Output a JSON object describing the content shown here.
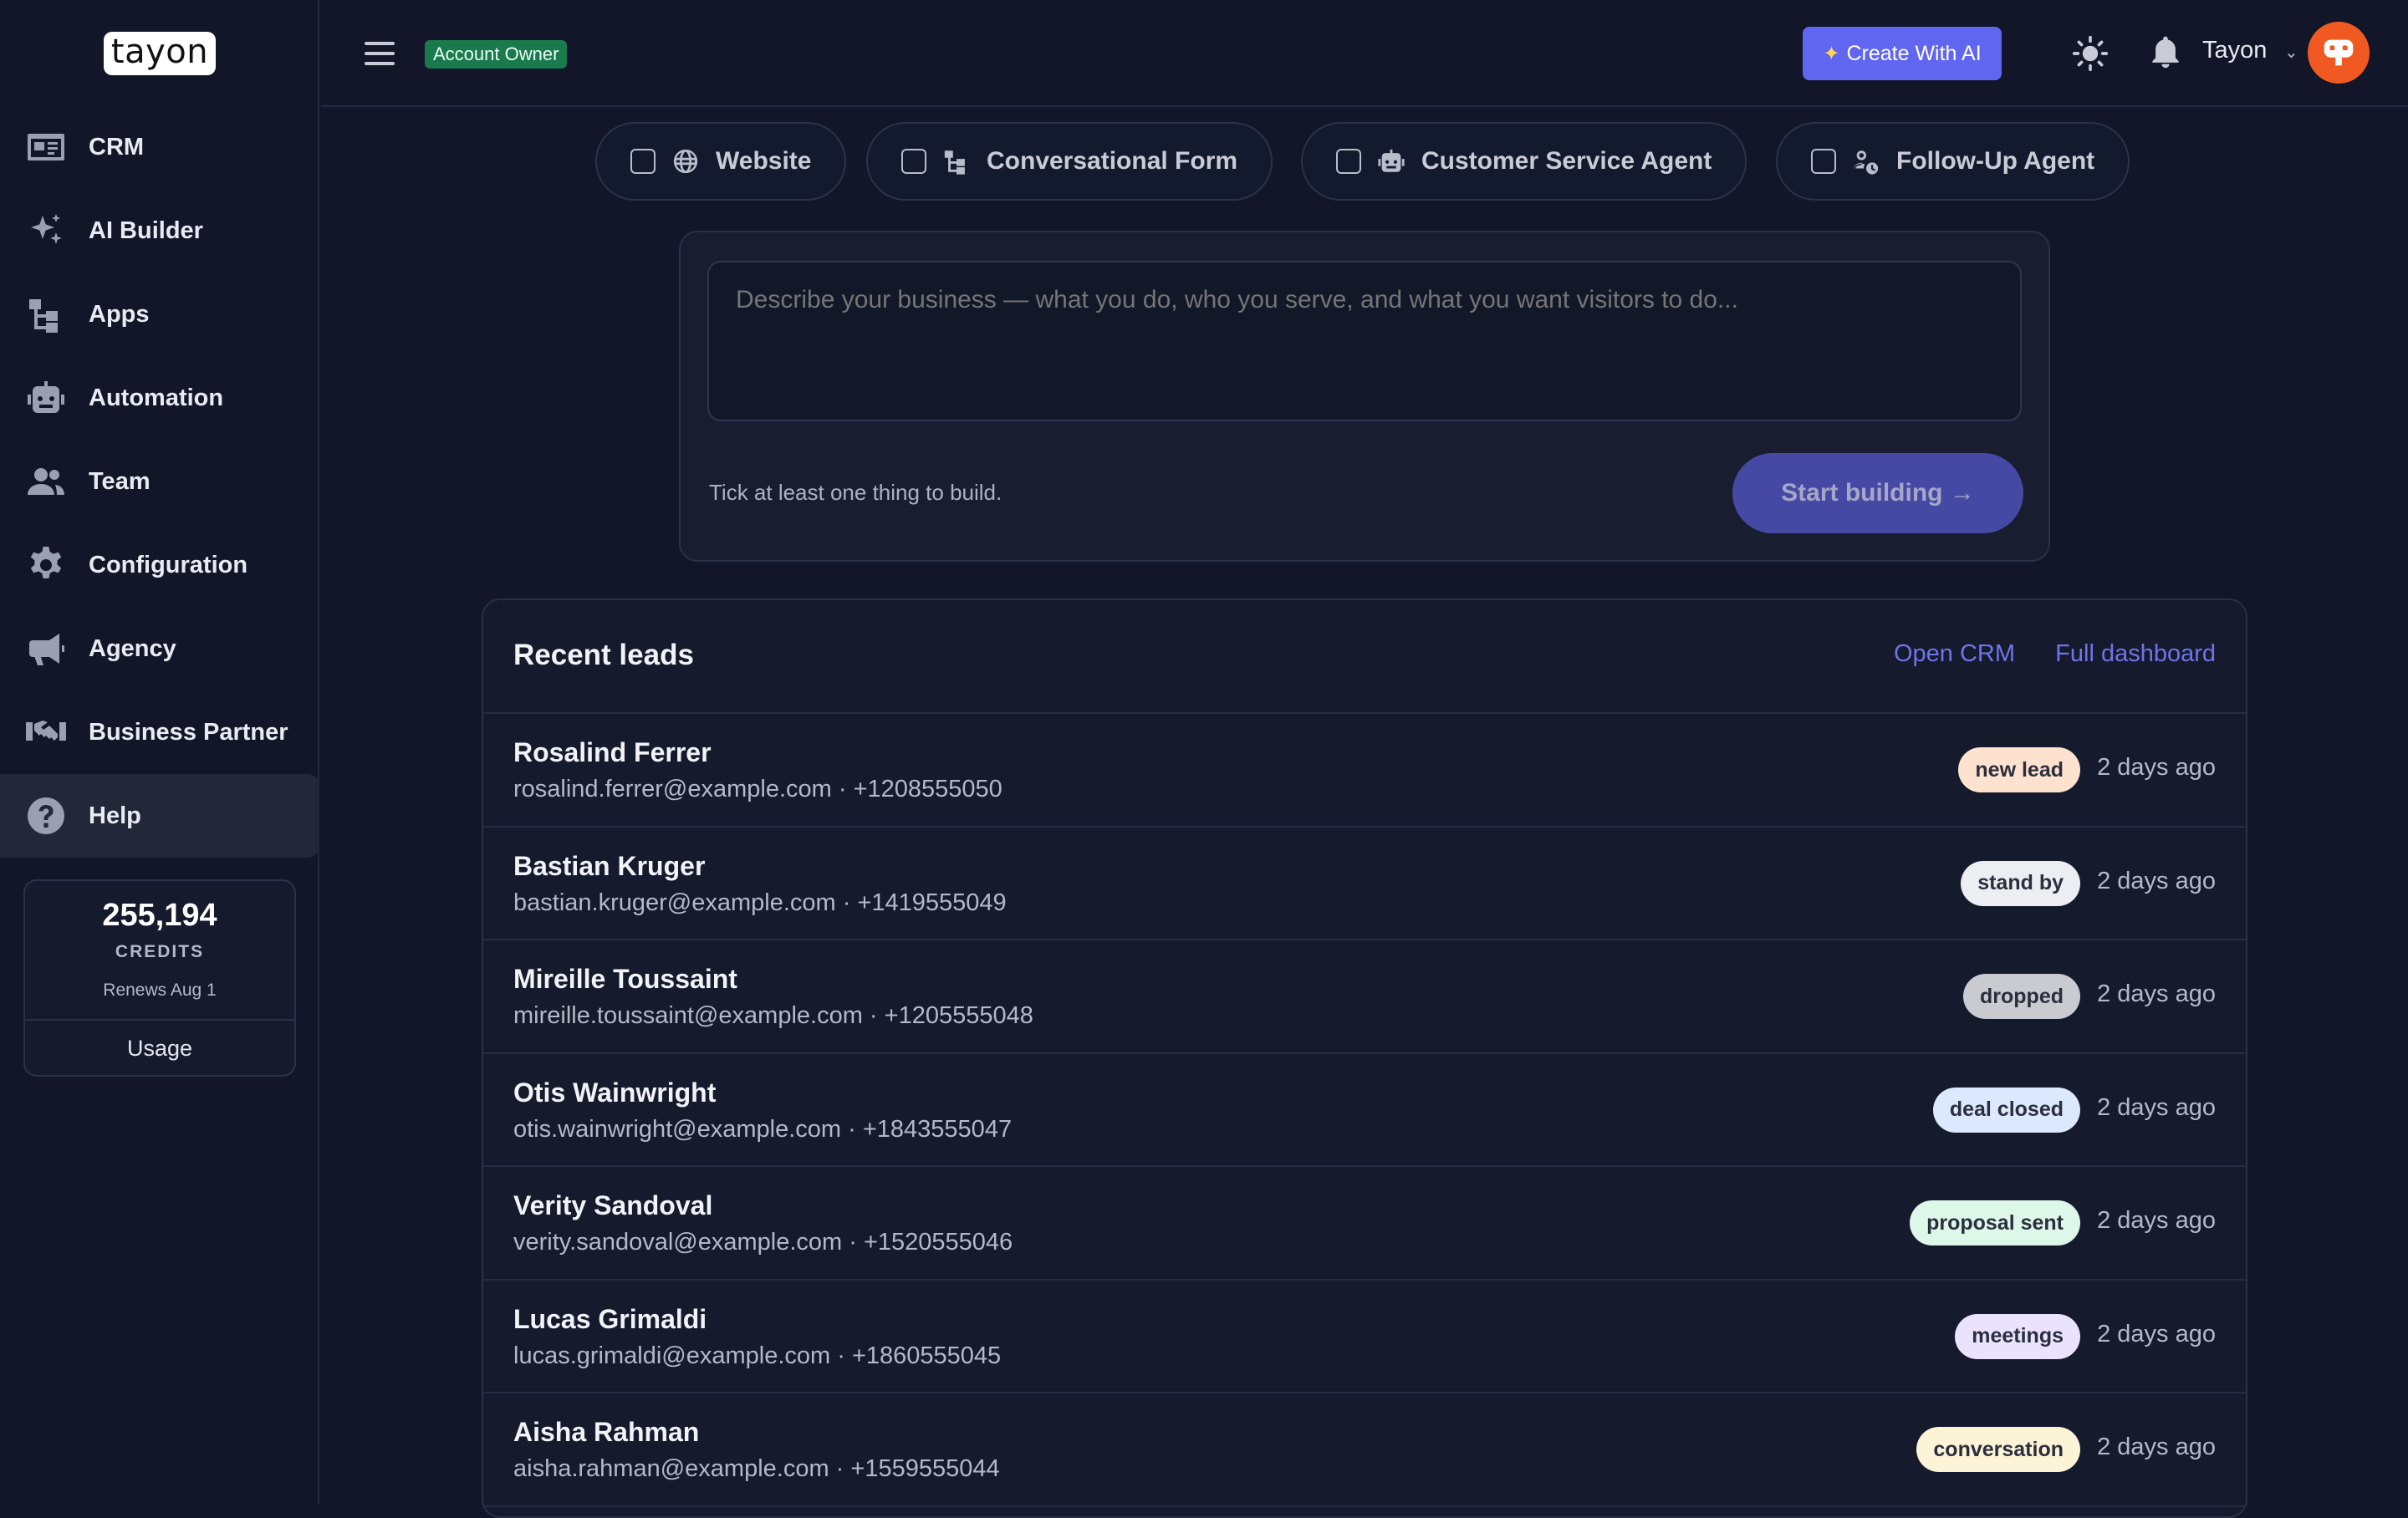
{
  "brand": {
    "logo_text": "tayon"
  },
  "sidebar": {
    "items": [
      {
        "label": "CRM",
        "icon": "id-card-icon"
      },
      {
        "label": "AI Builder",
        "icon": "sparkles-icon"
      },
      {
        "label": "Apps",
        "icon": "sitemap-icon"
      },
      {
        "label": "Automation",
        "icon": "robot-icon"
      },
      {
        "label": "Team",
        "icon": "users-icon"
      },
      {
        "label": "Configuration",
        "icon": "gear-icon"
      },
      {
        "label": "Agency",
        "icon": "megaphone-icon"
      },
      {
        "label": "Business Partner",
        "icon": "handshake-icon"
      },
      {
        "label": "Help",
        "icon": "question-icon",
        "active": true
      }
    ],
    "credits": {
      "amount": "255,194",
      "label": "CREDITS",
      "renews": "Renews Aug 1",
      "usage_label": "Usage"
    }
  },
  "header": {
    "role_badge": "Account Owner",
    "create_ai_label": "Create With AI",
    "user_name": "Tayon",
    "colors": {
      "accent": "#6166f0",
      "badge": "#1a7a4e",
      "avatar": "#f05a22"
    }
  },
  "builder": {
    "chips": [
      {
        "label": "Website",
        "icon": "globe-icon",
        "checked": false
      },
      {
        "label": "Conversational Form",
        "icon": "sitemap-icon",
        "checked": false
      },
      {
        "label": "Customer Service Agent",
        "icon": "robot-icon",
        "checked": false
      },
      {
        "label": "Follow-Up Agent",
        "icon": "user-clock-icon",
        "checked": false
      }
    ],
    "placeholder": "Describe your business — what you do, who you serve, and what you want visitors to do...",
    "hint": "Tick at least one thing to build.",
    "start_label": "Start building →"
  },
  "leads": {
    "title": "Recent leads",
    "links": {
      "open_crm": "Open CRM",
      "full_dashboard": "Full dashboard"
    },
    "rows": [
      {
        "name": "Rosalind Ferrer",
        "contact": "rosalind.ferrer@example.com · +1208555050",
        "status": "new lead",
        "status_color": "#fde2cf",
        "time": "2 days ago"
      },
      {
        "name": "Bastian Kruger",
        "contact": "bastian.kruger@example.com · +1419555049",
        "status": "stand by",
        "status_color": "#eceef2",
        "time": "2 days ago"
      },
      {
        "name": "Mireille Toussaint",
        "contact": "mireille.toussaint@example.com · +1205555048",
        "status": "dropped",
        "status_color": "#c9cbd1",
        "time": "2 days ago"
      },
      {
        "name": "Otis Wainwright",
        "contact": "otis.wainwright@example.com · +1843555047",
        "status": "deal closed",
        "status_color": "#dbe8fd",
        "time": "2 days ago"
      },
      {
        "name": "Verity Sandoval",
        "contact": "verity.sandoval@example.com · +1520555046",
        "status": "proposal sent",
        "status_color": "#ddf7e9",
        "time": "2 days ago"
      },
      {
        "name": "Lucas Grimaldi",
        "contact": "lucas.grimaldi@example.com · +1860555045",
        "status": "meetings",
        "status_color": "#ebe2fd",
        "time": "2 days ago"
      },
      {
        "name": "Aisha Rahman",
        "contact": "aisha.rahman@example.com · +1559555044",
        "status": "conversation",
        "status_color": "#fdf3d6",
        "time": "2 days ago"
      }
    ]
  }
}
